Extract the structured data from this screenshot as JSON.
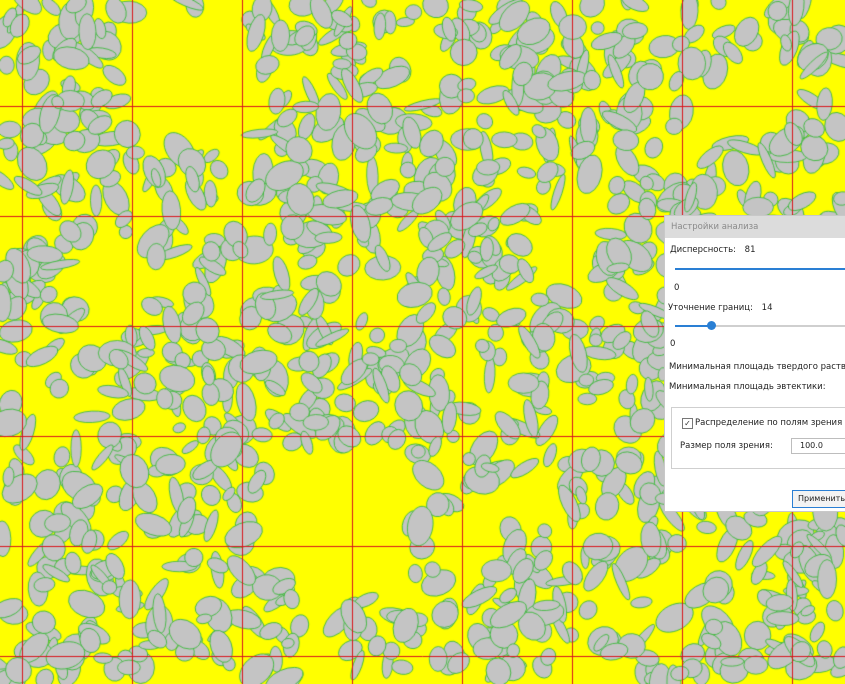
{
  "colors": {
    "background": "#ffff00",
    "particle": "#c4c4c4",
    "grid_line": "#d8141c",
    "boundary": "#35b835",
    "accent": "#2a7fd4"
  },
  "analysis_panel": {
    "title": "Настройки анализа",
    "dispersity": {
      "label": "Дисперсность:",
      "value": "81",
      "min_label": "0",
      "fill_fraction": 0.97
    },
    "boundary_refinement": {
      "label": "Уточнение границ:",
      "value": "14",
      "min_label": "0",
      "fill_fraction": 0.19
    },
    "min_solid_solution_area": {
      "label": "Минимальная площадь твердого раствора:"
    },
    "min_eutectic_area": {
      "label": "Минимальная площадь эвтектики:"
    },
    "field_distribution": {
      "checkbox_label": "Распределение по полям зрения",
      "checked": true,
      "checkmark": "✓",
      "field_size_label": "Размер поля зрения:",
      "field_size_value": "100.0"
    },
    "apply_button": "Применить"
  }
}
